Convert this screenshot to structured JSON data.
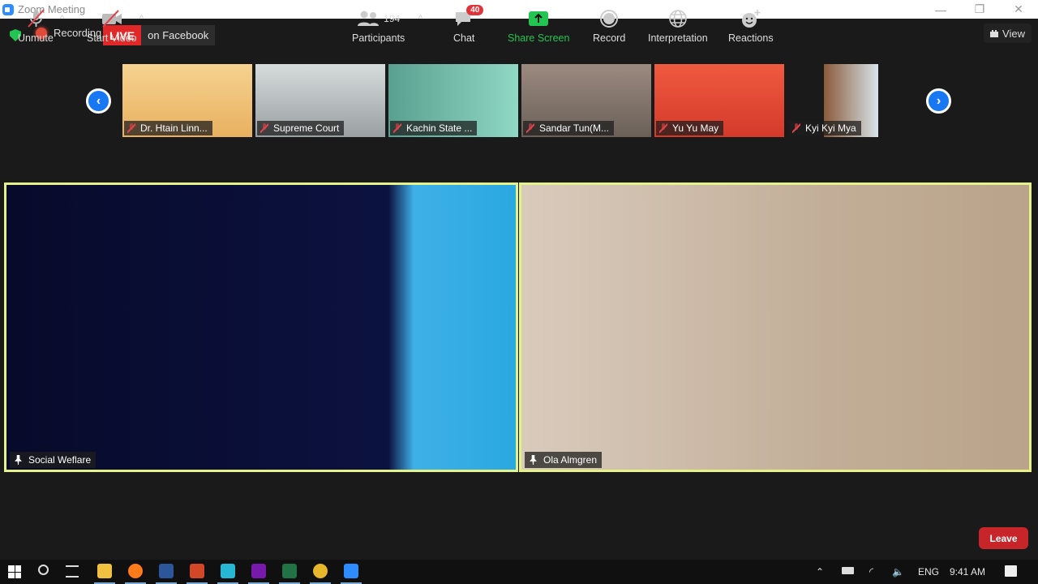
{
  "window": {
    "title": "Zoom Meeting",
    "minimize": "—",
    "restore": "❐",
    "close": "✕"
  },
  "topbar": {
    "recording_label": "Recording",
    "live_badge": "LIVE",
    "live_platform": "on Facebook",
    "view_label": "View"
  },
  "gallery": {
    "prev": "‹",
    "next": "›",
    "participants": [
      {
        "name": "Dr. Htain Linn...",
        "bg": "#f2c47a"
      },
      {
        "name": "Supreme Court",
        "bg": "#c9ced0"
      },
      {
        "name": "Kachin State ...",
        "bg": "#7fc8b8"
      },
      {
        "name": "Sandar Tun(M...",
        "bg": "#8a7a70"
      },
      {
        "name": "Yu Yu May",
        "bg": "#e8483a"
      },
      {
        "name": "Kyi Kyi Mya",
        "bg": "#1a1a1a"
      }
    ]
  },
  "speakers": [
    {
      "name": "Social Weflare",
      "bg": "#0a0e30"
    },
    {
      "name": "Ola Almgren",
      "bg": "#c9b8a4"
    }
  ],
  "toolbar": {
    "unmute": "Unmute",
    "start_video": "Start Video",
    "participants": "Participants",
    "participant_count": "194",
    "chat": "Chat",
    "chat_badge": "40",
    "share_screen": "Share Screen",
    "record": "Record",
    "interpretation": "Interpretation",
    "reactions": "Reactions",
    "leave": "Leave",
    "caret": "^"
  },
  "taskbar": {
    "lang": "ENG",
    "time": "9:41 AM",
    "apps": [
      {
        "name": "file-explorer",
        "color": "#f0c040"
      },
      {
        "name": "firefox",
        "color": "#ff7a1a"
      },
      {
        "name": "word",
        "color": "#2b579a"
      },
      {
        "name": "powerpoint",
        "color": "#d24726"
      },
      {
        "name": "whatsapp",
        "color": "#25b7d3"
      },
      {
        "name": "onenote",
        "color": "#7719aa"
      },
      {
        "name": "excel",
        "color": "#217346"
      },
      {
        "name": "chrome",
        "color": "#e8b62a"
      },
      {
        "name": "zoom",
        "color": "#2d8cff"
      }
    ]
  },
  "colors": {
    "accent": "#1877f2",
    "active_speaker": "#e5f28a",
    "share": "#23c552",
    "leave": "#c8252b",
    "live": "#e02828"
  }
}
